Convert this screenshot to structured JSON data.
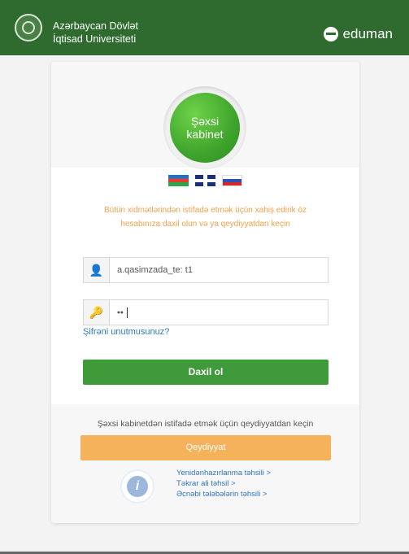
{
  "header": {
    "university_line1": "Azərbaycan Dövlət",
    "university_line2": "İqtisad Universiteti",
    "brand_name": "eduman"
  },
  "card": {
    "badge_line1": "Şəxsi",
    "badge_line2": "kabinet",
    "flags": [
      "azerbaijan-flag",
      "uk-flag",
      "russia-flag"
    ],
    "notice_line1": "Bütün xidmətlərindən istifadə etmək üçün xahiş edirik öz",
    "notice_line2": "hesabınıza daxil olun və ya qeydiyyatdan keçin",
    "username_value": "a.qasimzada_te: t1",
    "password_masked": "••",
    "forgot_link": "Şifrəni unutmusunuz?",
    "login_button": "Daxil ol",
    "register_note": "Şəxsi kabinetdən istifadə etmək üçün qeydiyyatdan keçin",
    "register_button": "Qeydiyyat",
    "info_links": [
      "Yenidənhazırlanma təhsili >",
      "Təkrar ali təhsil >",
      "Əcnəbi tələbələrin təhsili >"
    ]
  },
  "colors": {
    "header_green": "#2f6b2f",
    "accent_green": "#3f9a3a",
    "accent_orange": "#f6b25b",
    "link_blue": "#2f74c0",
    "notice_orange": "#f2a24b"
  }
}
